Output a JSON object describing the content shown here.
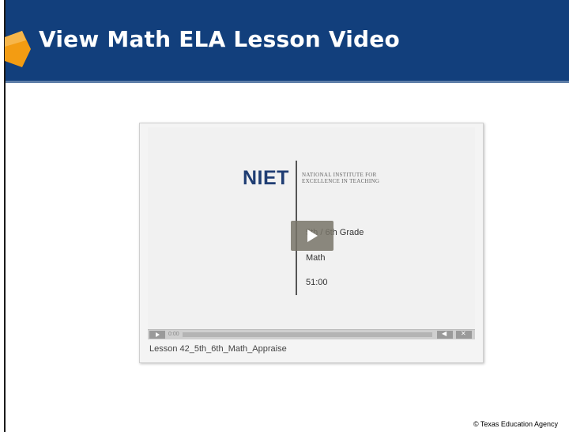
{
  "header": {
    "title": "View Math ELA Lesson Video",
    "icon": "orange-hexagon-icon",
    "colors": {
      "background": "#123f7c",
      "accent": "#f39c12"
    }
  },
  "video": {
    "logo_text": "NIET",
    "logo_subtitle": "National Institute for Excellence in Teaching",
    "grade": "5th / 6th Grade",
    "subject": "Math",
    "duration": "51:00",
    "play_icon": "play-icon",
    "controls": {
      "play_icon": "play-icon",
      "time": "0:00",
      "volume_icon": "volume-icon",
      "fullscreen_icon": "fullscreen-icon"
    },
    "caption": "Lesson 42_5th_6th_Math_Appraise"
  },
  "footer": {
    "copyright": "© Texas Education Agency"
  }
}
